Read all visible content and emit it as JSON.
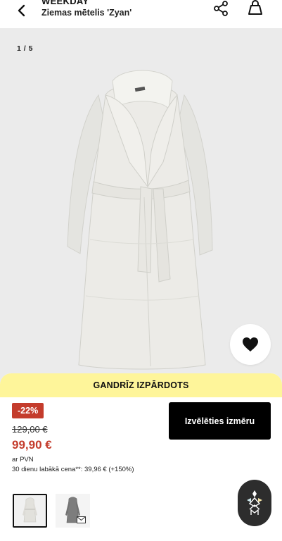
{
  "header": {
    "brand": "WEEKDAY",
    "product_title": "Ziemas mētelis 'Zyan'",
    "icons": {
      "back": "chevron-left-icon",
      "share": "share-icon",
      "bag": "shopping-bag-icon"
    }
  },
  "gallery": {
    "counter": "1 / 5",
    "favorite_icon": "heart-icon"
  },
  "panel": {
    "stock_notice": "GANDRĪZ IZPĀRDOTS",
    "discount_badge": "-22%",
    "old_price": "129,00 €",
    "new_price": "99,90 €",
    "vat_note": "ar PVN",
    "best_price_note": "30 dienu labākā cena**: 39,96 € (+150%)",
    "select_size_button": "Izvēlēties izmēru",
    "thumbnails": [
      "thumbnail-white-coat",
      "thumbnail-grey-coat"
    ]
  },
  "colors": {
    "accent_red": "#c43c2c",
    "notice_yellow": "#fef59a",
    "button_black": "#000000",
    "gallery_bg": "#ebebeb"
  }
}
